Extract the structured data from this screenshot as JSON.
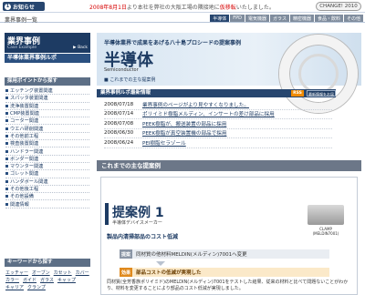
{
  "notice": {
    "badge_num": "1",
    "badge_label": "お知らせ",
    "text_red": "2008年8月1日",
    "text_rest": "より本社を弊社の大阪工場の隣接地に",
    "text_red2": "仮移転",
    "text_end": "いたしました。",
    "change_logo": "CHANGE! 2010"
  },
  "header": {
    "breadcrumb": "業界事例一覧",
    "nav": [
      "半導体",
      "FPD",
      "電気機器",
      "ガラス",
      "精密機器",
      "食品・飲料",
      "その他"
    ]
  },
  "sidebar": {
    "title": "業界事例",
    "subtitle": "Case Example",
    "back": "▶ Back",
    "section_label": "半導体業界事例ルポ",
    "points_label": "採用ポイントから探す",
    "items": [
      "エッチング装置関連",
      "スパッタ装置関連",
      "洗浄装置関連",
      "CMP装置関連",
      "コーター関連",
      "ウエハ研削関連",
      "その他前工程",
      "検査装置関連",
      "ハンドラー関連",
      "ボンダー関連",
      "マウンター関連",
      "ゴレット関連",
      "ハンダボール関連",
      "その他後工程",
      "その他設備",
      "関連情報"
    ],
    "keyword_label": "キーワードから探す",
    "keywords": [
      "エッチャー",
      "オーブン",
      "カセット",
      "カバー",
      "カラー",
      "ガイド",
      "ガラス",
      "キャップ",
      "キャリア",
      "クランプ"
    ]
  },
  "hero": {
    "tagline": "半導体業界で成果をあげる八十島プロシードの提案事例",
    "title": "半導体",
    "title_en": "Semiconductor",
    "sub": "これまでの主な提案例"
  },
  "news": {
    "header": "業界事例ルポ最新情報",
    "rss": "RSS",
    "mail": "最新情報をお届け",
    "rows": [
      {
        "date": "2008/07/18",
        "title": "業界事例のページがより見やすくなりました。"
      },
      {
        "date": "2008/07/14",
        "title": "ポリイミド樹脂メルディン、インサートの差け部品に採用"
      },
      {
        "date": "2008/07/08",
        "title": "PEEK樹脂が、搬送装置の部品に採用"
      },
      {
        "date": "2008/06/30",
        "title": "PEEK樹脂が真空装置機の部品で採用"
      },
      {
        "date": "2008/06/24",
        "title": "PEI樹脂セラゾール"
      }
    ]
  },
  "case": {
    "section_header": "これまでの主な提案例",
    "number": "提案例 1",
    "category": "半導体デバイスメーカー",
    "description": "製品内清掃部品のコスト低減",
    "product_caption_1": "CLAMP",
    "product_caption_2": "(MELDIN7001)",
    "step1_tag": "提案",
    "step1": "同材質の他材料MELDIN(メルディン)7001へ変更",
    "step2_tag": "効果",
    "step2": "部品コストの低減が実現した",
    "body": "同材質(全芳香族ポリイミド)のMELDIN(メルディン)7001をテストした結果、従来の材料と比べて問題ないことがわかり、材料を変更することにより部品のコスト低減が実現しました。"
  }
}
